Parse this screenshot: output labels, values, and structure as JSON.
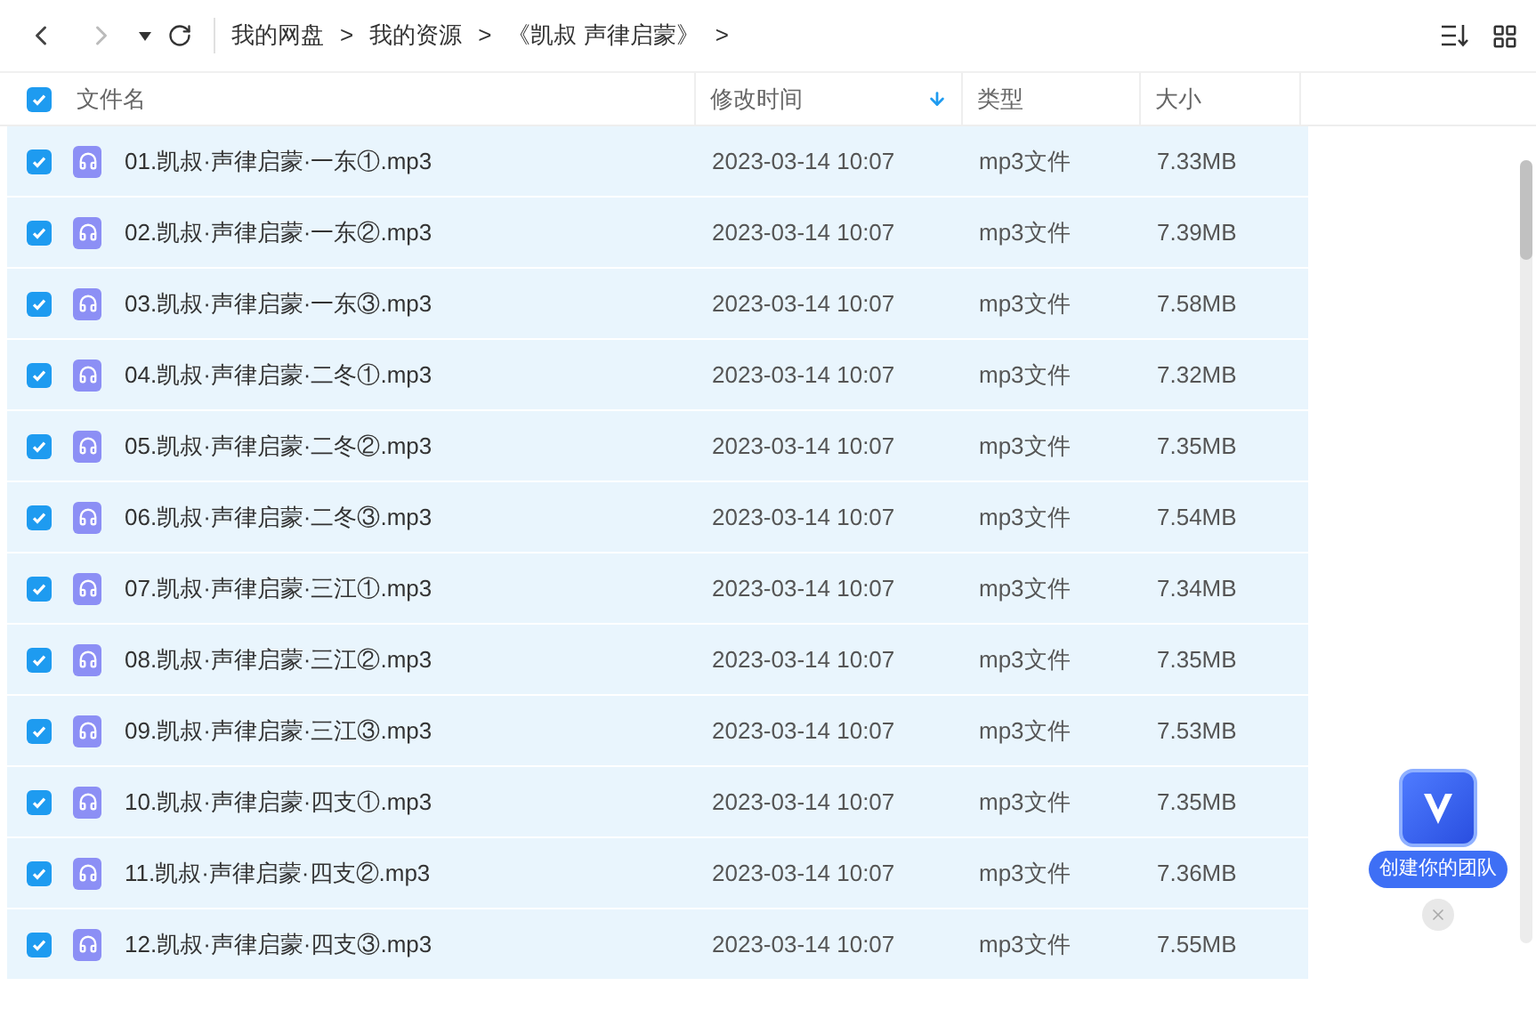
{
  "toolbar": {
    "breadcrumbs": [
      "我的网盘",
      "我的资源",
      "《凯叔 声律启蒙》"
    ],
    "separator": ">"
  },
  "table": {
    "select_all": {
      "checked": true
    },
    "columns": [
      {
        "label": "文件名",
        "sorted": false
      },
      {
        "label": "修改时间",
        "sorted": true
      },
      {
        "label": "类型",
        "sorted": false
      },
      {
        "label": "大小",
        "sorted": false
      }
    ],
    "rows": [
      {
        "name": "01.凯叔·声律启蒙·一东①.mp3",
        "modified": "2023-03-14 10:07",
        "type": "mp3文件",
        "size": "7.33MB",
        "checked": true
      },
      {
        "name": "02.凯叔·声律启蒙·一东②.mp3",
        "modified": "2023-03-14 10:07",
        "type": "mp3文件",
        "size": "7.39MB",
        "checked": true
      },
      {
        "name": "03.凯叔·声律启蒙·一东③.mp3",
        "modified": "2023-03-14 10:07",
        "type": "mp3文件",
        "size": "7.58MB",
        "checked": true
      },
      {
        "name": "04.凯叔·声律启蒙·二冬①.mp3",
        "modified": "2023-03-14 10:07",
        "type": "mp3文件",
        "size": "7.32MB",
        "checked": true
      },
      {
        "name": "05.凯叔·声律启蒙·二冬②.mp3",
        "modified": "2023-03-14 10:07",
        "type": "mp3文件",
        "size": "7.35MB",
        "checked": true
      },
      {
        "name": "06.凯叔·声律启蒙·二冬③.mp3",
        "modified": "2023-03-14 10:07",
        "type": "mp3文件",
        "size": "7.54MB",
        "checked": true
      },
      {
        "name": "07.凯叔·声律启蒙·三江①.mp3",
        "modified": "2023-03-14 10:07",
        "type": "mp3文件",
        "size": "7.34MB",
        "checked": true
      },
      {
        "name": "08.凯叔·声律启蒙·三江②.mp3",
        "modified": "2023-03-14 10:07",
        "type": "mp3文件",
        "size": "7.35MB",
        "checked": true
      },
      {
        "name": "09.凯叔·声律启蒙·三江③.mp3",
        "modified": "2023-03-14 10:07",
        "type": "mp3文件",
        "size": "7.53MB",
        "checked": true
      },
      {
        "name": "10.凯叔·声律启蒙·四支①.mp3",
        "modified": "2023-03-14 10:07",
        "type": "mp3文件",
        "size": "7.35MB",
        "checked": true
      },
      {
        "name": "11.凯叔·声律启蒙·四支②.mp3",
        "modified": "2023-03-14 10:07",
        "type": "mp3文件",
        "size": "7.36MB",
        "checked": true
      },
      {
        "name": "12.凯叔·声律启蒙·四支③.mp3",
        "modified": "2023-03-14 10:07",
        "type": "mp3文件",
        "size": "7.55MB",
        "checked": true
      }
    ]
  },
  "promo": {
    "label": "创建你的团队"
  }
}
